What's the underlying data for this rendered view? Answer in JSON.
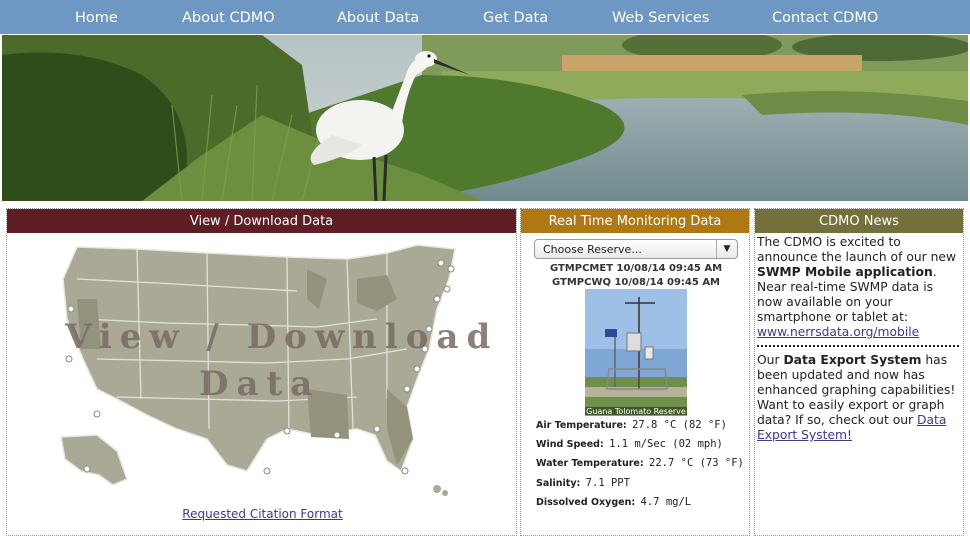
{
  "nav": {
    "items": [
      "Home",
      "About CDMO",
      "About Data",
      "Get Data",
      "Web Services",
      "Contact CDMO"
    ]
  },
  "view_panel": {
    "title": "View / Download Data",
    "map_text_line1": "View / Download",
    "map_text_line2": "Data",
    "citation_link": "Requested Citation Format"
  },
  "realtime_panel": {
    "title": "Real Time Monitoring Data",
    "select_value": "Choose Reserve...",
    "met_stamp": "GTMPCMET 10/08/14 09:45 AM",
    "wq_stamp": "GTMPCWQ 10/08/14 09:45 AM",
    "photo_caption": "Guana Tolomato Reserve",
    "readings": [
      {
        "label": "Air Temperature:",
        "value": "27.8 °C (82 °F)"
      },
      {
        "label": "Wind Speed:",
        "value": "1.1 m/Sec (02 mph)"
      },
      {
        "label": "Water Temperature:",
        "value": "22.7 °C (73 °F)"
      },
      {
        "label": "Salinity:",
        "value": "7.1 PPT"
      },
      {
        "label": "Dissolved Oxygen:",
        "value": "4.7 mg/L"
      }
    ]
  },
  "news_panel": {
    "title": "CDMO News",
    "item1_text": "The CDMO is excited to announce the launch of our new",
    "item1_bold": "SWMP Mobile application",
    "item1_rest": ". Near real-time SWMP data is now available on your smartphone or tablet at:",
    "item1_link": "www.nerrsdata.org/mobile",
    "item2_pre": "Our",
    "item2_bold": "Data Export System",
    "item2_text": "has been updated and now has enhanced graphing capabilities! Want to easily export or graph data? If so, check out our",
    "item2_link": "Data Export System!"
  },
  "colors": {
    "nav": "#6e98c3",
    "view_header": "#5e1e23",
    "realtime_header": "#b07812",
    "news_header": "#74703c",
    "map_land": "#a9a996"
  }
}
